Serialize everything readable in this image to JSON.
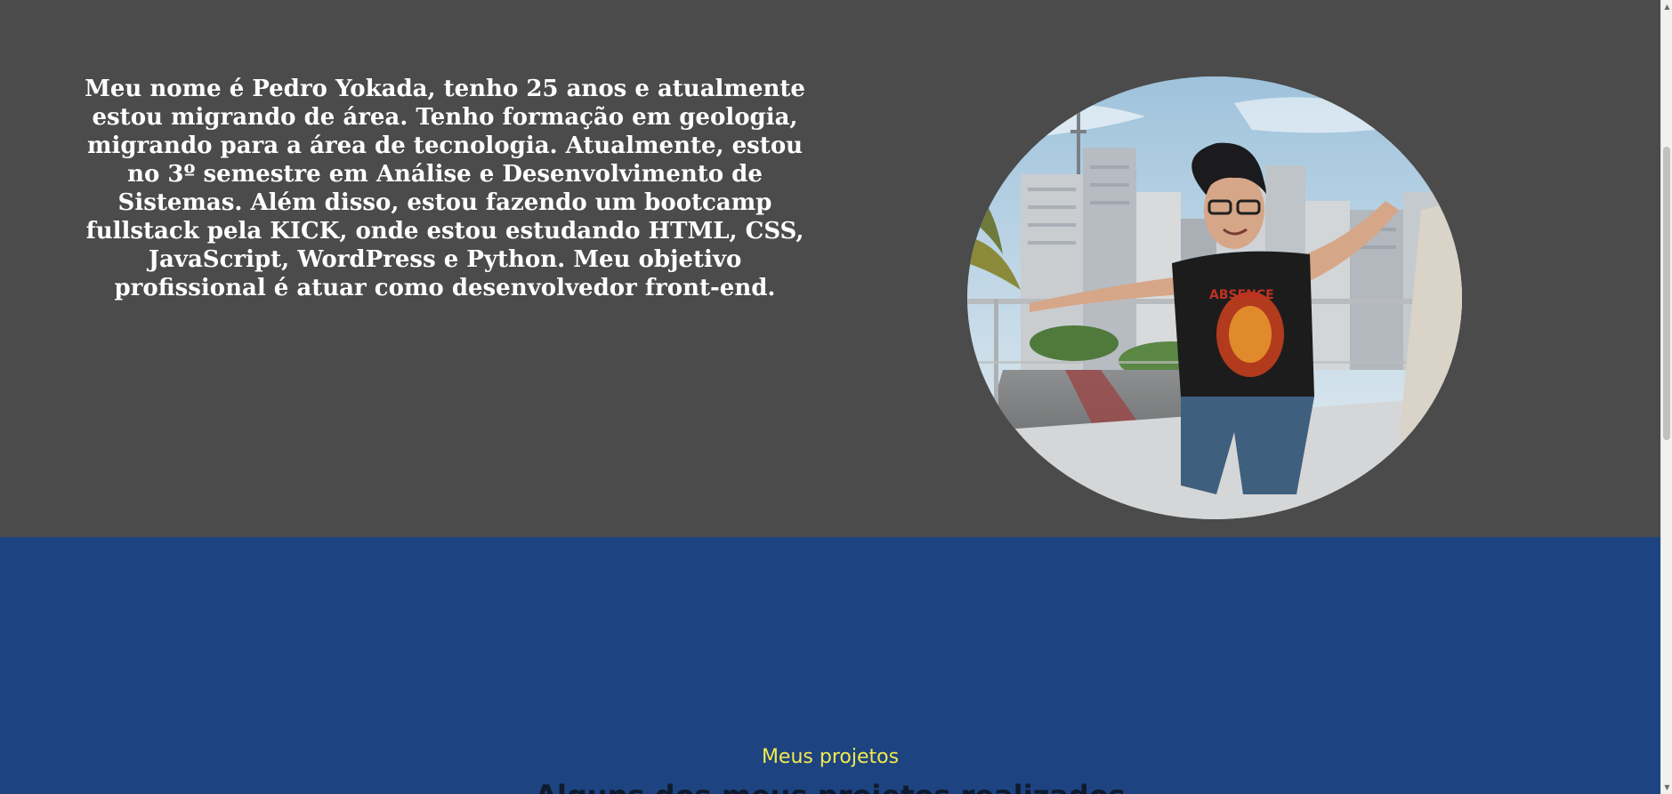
{
  "about": {
    "text": "Meu nome é Pedro Yokada, tenho 25 anos e atualmente estou migrando de área. Tenho formação em geologia, migrando para a área de tecnologia. Atualmente, estou no 3º semestre em Análise e Desenvolvimento de Sistemas. Além disso, estou fazendo um bootcamp fullstack pela KICK, onde estou estudando HTML, CSS, JavaScript, WordPress e Python. Meu objetivo profissional é atuar como desenvolvedor front-end.",
    "shirt_print": "ABSENCE"
  },
  "projects": {
    "eyebrow": "Meus projetos",
    "heading": "Alguns dos meus projetos realizados"
  },
  "scrollbar": {
    "up_icon": "▲",
    "down_icon": "▼"
  },
  "colors": {
    "about_bg": "#4b4b4b",
    "projects_bg": "#1d4480",
    "eyebrow": "#f2e94e",
    "heading": "#0f1a2d"
  }
}
